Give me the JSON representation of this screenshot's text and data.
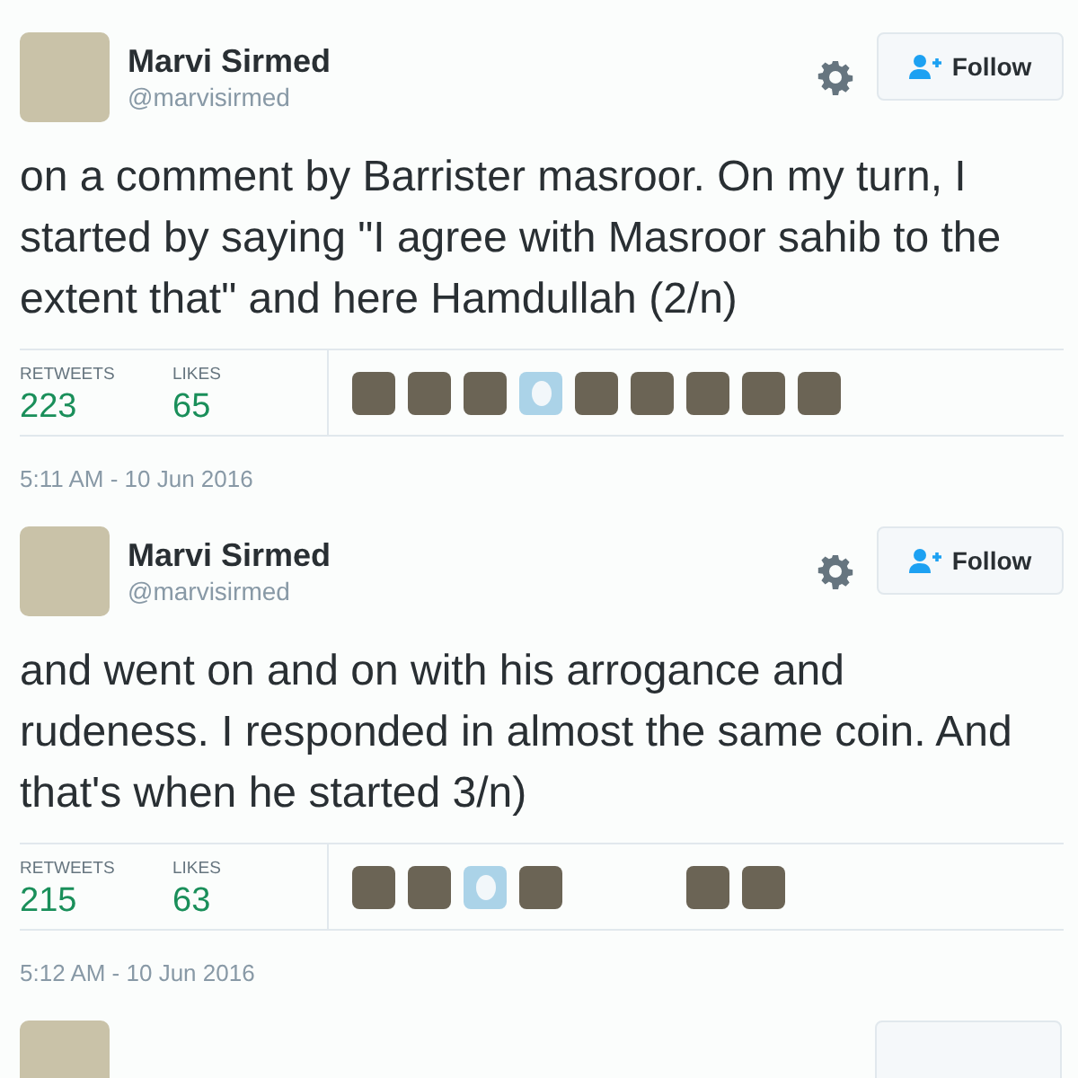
{
  "tweets": [
    {
      "name": "Marvi Sirmed",
      "handle": "@marvisirmed",
      "follow_label": "Follow",
      "text": "on a comment by Barrister masroor. On my turn, I started by saying \"I agree with Masroor sahib to the extent that\" and here Hamdullah (2/n)",
      "stats": [
        {
          "label": "RETWEETS",
          "value": "223"
        },
        {
          "label": "LIKES",
          "value": "65"
        }
      ],
      "likers": [
        {
          "kind": "photo"
        },
        {
          "kind": "photo"
        },
        {
          "kind": "photo"
        },
        {
          "kind": "egg"
        },
        {
          "kind": "photo"
        },
        {
          "kind": "photo"
        },
        {
          "kind": "photo"
        },
        {
          "kind": "photo"
        },
        {
          "kind": "photo"
        }
      ],
      "timestamp": "5:11 AM - 10 Jun 2016"
    },
    {
      "name": "Marvi Sirmed",
      "handle": "@marvisirmed",
      "follow_label": "Follow",
      "text": "and went on and on with his arrogance and rudeness. I responded in almost the same coin. And that's when he started 3/n)",
      "stats": [
        {
          "label": "RETWEETS",
          "value": "215"
        },
        {
          "label": "LIKES",
          "value": "63"
        }
      ],
      "likers": [
        {
          "kind": "photo"
        },
        {
          "kind": "photo"
        },
        {
          "kind": "egg"
        },
        {
          "kind": "photo"
        },
        {
          "kind": "empty"
        },
        {
          "kind": "empty"
        },
        {
          "kind": "photo"
        },
        {
          "kind": "photo"
        }
      ],
      "timestamp": "5:12 AM - 10 Jun 2016"
    }
  ]
}
